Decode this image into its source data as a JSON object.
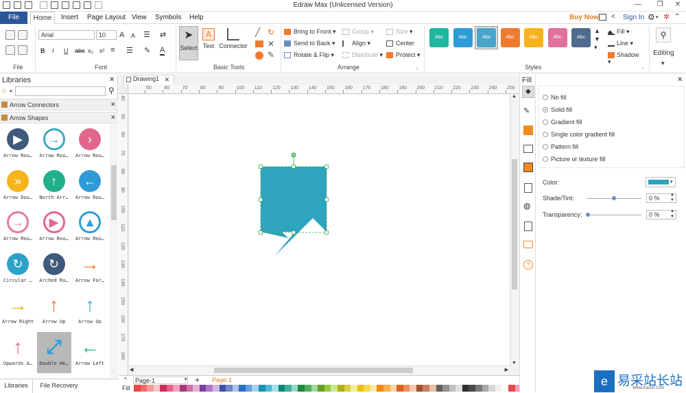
{
  "window": {
    "title": "Edraw Max (Unlicensed Version)"
  },
  "menu": {
    "file": "File",
    "home": "Home",
    "insert": "Insert",
    "page_layout": "Page Layout",
    "view": "View",
    "symbols": "Symbols",
    "help": "Help",
    "buy_now": "Buy Now",
    "sign_in": "Sign In"
  },
  "ribbon": {
    "groups": {
      "file": "File",
      "font": "Font",
      "basic_tools": "Basic Tools",
      "arrange": "Arrange",
      "styles": "Styles"
    },
    "font": {
      "name": "Arial",
      "size": "10"
    },
    "tools": {
      "select": "Select",
      "text": "Text",
      "connector": "Connector"
    },
    "arrange": {
      "bring_to_front": "Bring to Front",
      "send_to_back": "Send to Back",
      "rotate_flip": "Rotate & Flip",
      "group": "Group",
      "align": "Align",
      "distribute": "Distribute",
      "size": "Size",
      "center": "Center",
      "protect": "Protect"
    },
    "style_label": "Abc",
    "style_colors": [
      "#20b59e",
      "#2e9bd6",
      "#4aa6c8",
      "#f07b2e",
      "#f5b41c",
      "#e1719d",
      "#4f6b8e"
    ],
    "fill_line": {
      "fill": "Fill",
      "line": "Line",
      "shadow": "Shadow"
    },
    "editing": "Editing"
  },
  "libraries": {
    "title": "Libraries",
    "search_placeholder": "",
    "sections": [
      "Arrow Connectors",
      "Arrow Shapes"
    ],
    "shapes": [
      {
        "label": "Arrow Rou…",
        "color": "#3f5a7a",
        "glyph": "▶",
        "style": "solid"
      },
      {
        "label": "Arrow Rou…",
        "color": "#3aa9c6",
        "glyph": "→",
        "style": "ring"
      },
      {
        "label": "Arrow Rou…",
        "color": "#e2668c",
        "glyph": "›",
        "style": "solid"
      },
      {
        "label": "Arrow Dou…",
        "color": "#f5b41c",
        "glyph": "»",
        "style": "solid"
      },
      {
        "label": "North Arr…",
        "color": "#21b08c",
        "glyph": "↑",
        "style": "solid"
      },
      {
        "label": "Arrow Rou…",
        "color": "#2e9bd6",
        "glyph": "←",
        "style": "solid"
      },
      {
        "label": "Arrow Rou…",
        "color": "#e27aa0",
        "glyph": "→",
        "style": "ring"
      },
      {
        "label": "Arrow Rou…",
        "color": "#e2668c",
        "glyph": "▶",
        "style": "ring"
      },
      {
        "label": "Arrow Rou…",
        "color": "#2e9bd6",
        "glyph": "▲",
        "style": "ring"
      },
      {
        "label": "Circular …",
        "color": "#2ea1c8",
        "glyph": "↻",
        "style": "solid"
      },
      {
        "label": "Arched Ro…",
        "color": "#3f5a7a",
        "glyph": "↻",
        "style": "solid"
      },
      {
        "label": "Arrow For…",
        "color": "#f07b2e",
        "glyph": "→",
        "style": "plain"
      },
      {
        "label": "Arrow Right",
        "color": "#f5b41c",
        "glyph": "→",
        "style": "plain"
      },
      {
        "label": "Arrow Up",
        "color": "#f07b2e",
        "glyph": "↑",
        "style": "plain"
      },
      {
        "label": "Arrow Up",
        "color": "#3aa9d8",
        "glyph": "↑",
        "style": "plain"
      },
      {
        "label": "Upwards A…",
        "color": "#e2668c",
        "glyph": "↑",
        "style": "plain"
      },
      {
        "label": "Double He…",
        "color": "#2e9bd6",
        "glyph": "⤢",
        "style": "selected"
      },
      {
        "label": "Arrow Left",
        "color": "#21b08c",
        "glyph": "←",
        "style": "plain"
      }
    ],
    "bottom_tabs": [
      "Libraries",
      "File Recovery"
    ]
  },
  "document": {
    "tab": "Drawing1",
    "page_tab": "Page-1",
    "active_page": "Page-1",
    "color_bar_label": "Fill",
    "ruler_h": [
      "50",
      "60",
      "70",
      "80",
      "90",
      "100",
      "110",
      "120",
      "130",
      "140",
      "150",
      "160",
      "170",
      "180",
      "190",
      "200",
      "210",
      "220",
      "230",
      "240",
      "250",
      "260"
    ],
    "ruler_v": [
      "40",
      "50",
      "60",
      "70",
      "80",
      "90",
      "100",
      "110",
      "120",
      "130",
      "140",
      "150",
      "160",
      "170",
      "180"
    ],
    "shape_color": "#2fa4bf"
  },
  "fill_panel": {
    "title": "Fill",
    "options": [
      "No fill",
      "Solid fill",
      "Gradient fill",
      "Single color gradient fill",
      "Pattern fill",
      "Picture or texture fill"
    ],
    "selected": "Solid fill",
    "color_label": "Color:",
    "shade_label": "Shade/Tint:",
    "shade_value": "0 %",
    "shade_level": 0.5,
    "transparency_label": "Transparency:",
    "transparency_value": "0 %",
    "transparency_level": 0,
    "color": "#2fa4bf"
  },
  "watermark": {
    "text": "易采站长站",
    "sub": "Www.Easck.Com"
  },
  "palette": [
    "#e84848",
    "#f06a6a",
    "#f29b9b",
    "#f7c7c7",
    "#c8305a",
    "#e6608a",
    "#f0a0be",
    "#a83878",
    "#d070a8",
    "#e8b0d0",
    "#7840a0",
    "#a878c8",
    "#d0b8e0",
    "#4050a8",
    "#7088d0",
    "#b0c0e8",
    "#2870c0",
    "#60a0e0",
    "#a8d0f0",
    "#1890b0",
    "#50b8d0",
    "#a0e0f0",
    "#108870",
    "#40b098",
    "#98d8c8",
    "#208840",
    "#50b060",
    "#a0d8a0",
    "#68a020",
    "#98c840",
    "#c8e890",
    "#b0b010",
    "#d8d040",
    "#f0f0a0",
    "#f0c010",
    "#f8d850",
    "#f8ecb0",
    "#f08a10",
    "#f8b050",
    "#f8d8a8",
    "#e06020",
    "#f09060",
    "#f8c8a8",
    "#a05030",
    "#c88060",
    "#e8c0a8",
    "#606060",
    "#909090",
    "#c0c0c0",
    "#e0e0e0",
    "#303030",
    "#484848",
    "#787878",
    "#a8a8a8",
    "#d8d8d8",
    "#f0f0f0",
    "#ffffff",
    "#e84848",
    "#f0a0be",
    "#a878c8",
    "#60a0e0",
    "#40b098",
    "#98c840",
    "#f8d850",
    "#f8b050",
    "#c88060",
    "#909090",
    "#2870c0",
    "#108870",
    "#f08a10"
  ]
}
